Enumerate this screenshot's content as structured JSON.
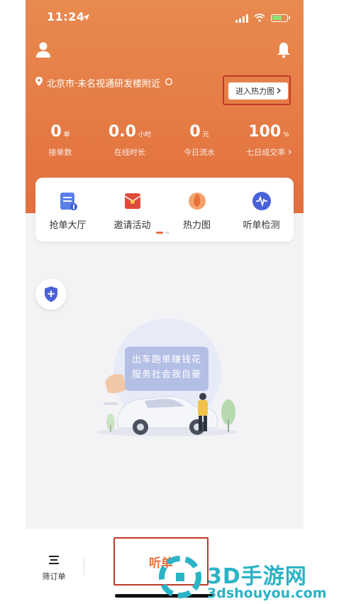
{
  "status_bar": {
    "time": "11:24"
  },
  "location": {
    "text": "北京市·未名视通研发楼附近"
  },
  "heatmap_button": {
    "label": "进入热力图"
  },
  "stats": [
    {
      "value": "0",
      "unit": "单",
      "label": "接单数"
    },
    {
      "value": "0.0",
      "unit": "小时",
      "label": "在线时长"
    },
    {
      "value": "0",
      "unit": "元",
      "label": "今日流水"
    },
    {
      "value": "100",
      "unit": "%",
      "label": "七日成交率"
    }
  ],
  "tools": [
    {
      "label": "抢单大厅",
      "icon": "order-hall-icon"
    },
    {
      "label": "邀请活动",
      "icon": "invite-icon"
    },
    {
      "label": "热力图",
      "icon": "heatmap-icon"
    },
    {
      "label": "听单检测",
      "icon": "listen-check-icon"
    }
  ],
  "illustration": {
    "line1": "出车跑单赚钱花",
    "line2": "服务社会我自豪"
  },
  "tabbar": {
    "filter_label": "筛订单",
    "listen_label": "听单"
  },
  "watermark": {
    "title": "3D手游网",
    "url": "3dshouyou.com"
  },
  "colors": {
    "brand": "#e57a44",
    "highlight_border": "#c0392b",
    "watermark": "#2bb3c6"
  }
}
